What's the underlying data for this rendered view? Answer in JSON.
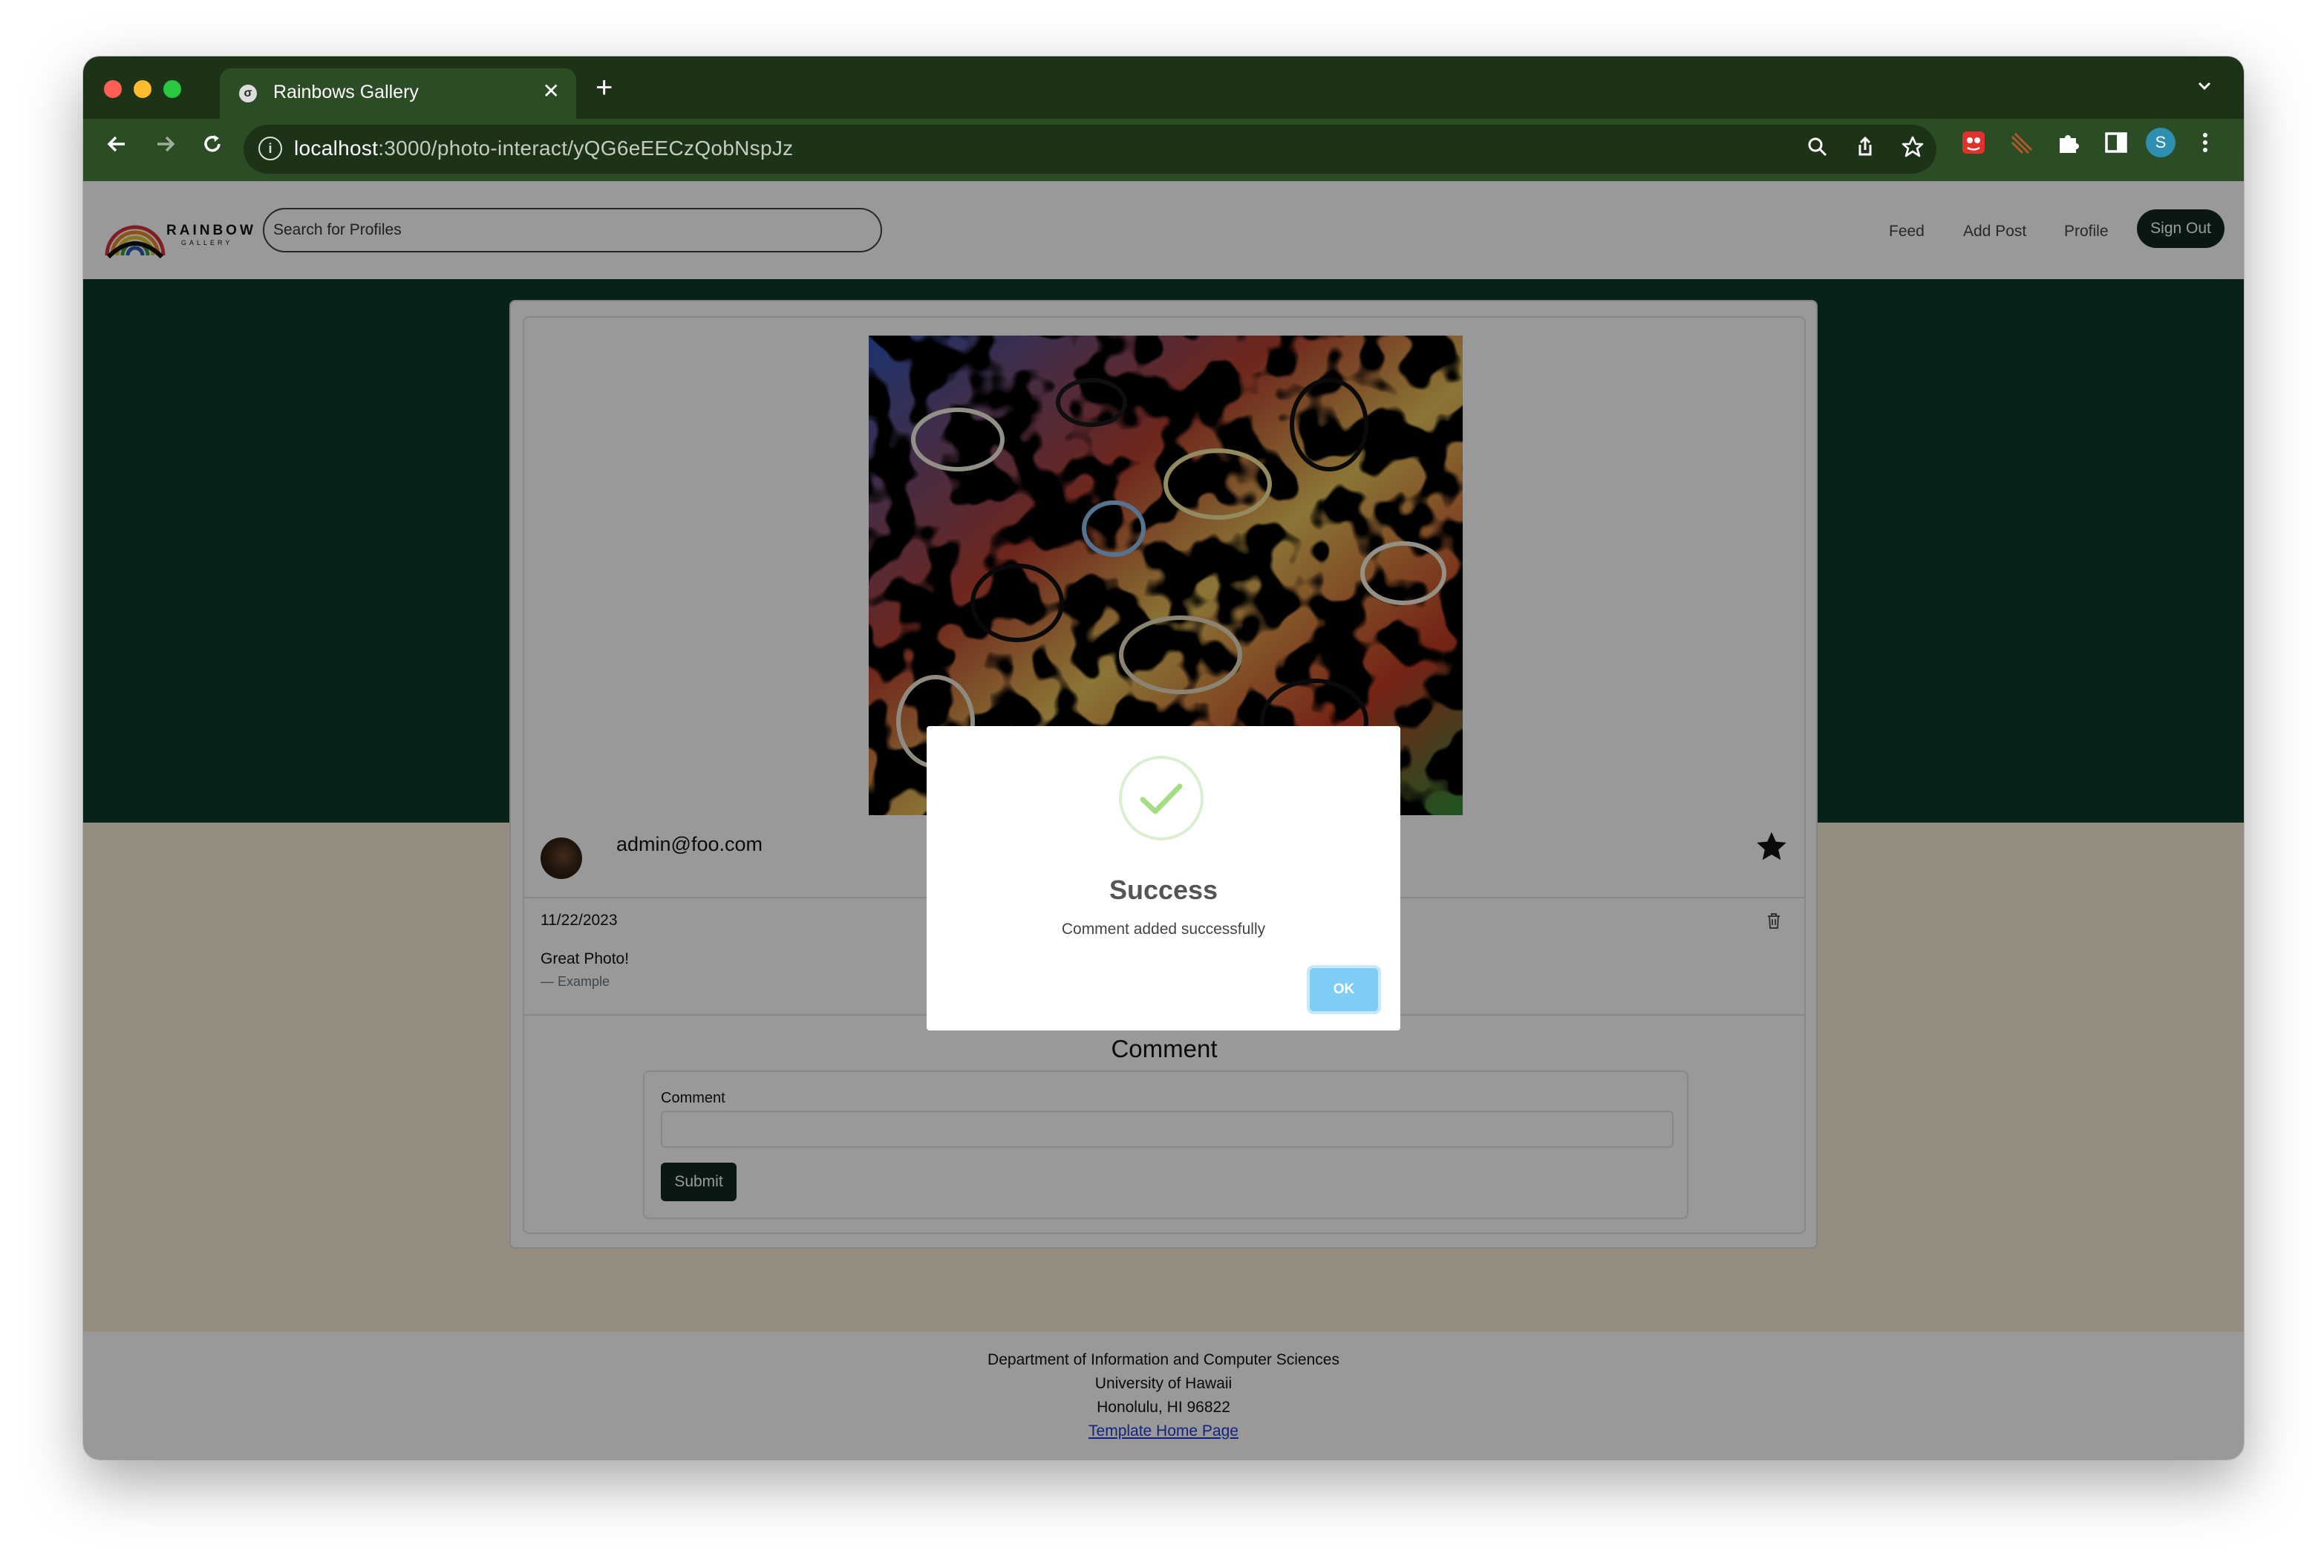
{
  "browser": {
    "tab_title": "Rainbows Gallery",
    "tab_close": "✕",
    "new_tab": "+",
    "url_host": "localhost",
    "url_path": ":3000/photo-interact/yQG6eEECzQobNspJz",
    "profile_initial": "S"
  },
  "navbar": {
    "logo_word": "RAINBOW",
    "logo_sub": "GALLERY",
    "search_placeholder": "Search for Profiles",
    "links": [
      "Feed",
      "Add Post",
      "Profile"
    ],
    "signout_label": "Sign Out"
  },
  "post": {
    "owner": "admin@foo.com",
    "comment_date": "11/22/2023",
    "comment_text": "Great Photo!",
    "comment_author": "— Example"
  },
  "comment_form": {
    "heading": "Comment",
    "field_label": "Comment",
    "submit_label": "Submit"
  },
  "modal": {
    "title": "Success",
    "message": "Comment added successfully",
    "ok_label": "OK"
  },
  "footer": {
    "line1": "Department of Information and Computer Sciences",
    "line2": "University of Hawaii",
    "line3": "Honolulu, HI 96822",
    "link": "Template Home Page"
  },
  "colors": {
    "chrome_dark": "#1c3318",
    "chrome_mid": "#2b4c25",
    "hero": "#0e3a2c",
    "tan": "#f7ecd5",
    "brand_button": "#0f2a1f",
    "ok_button": "#7fcdf5",
    "success_check": "#a5dc86"
  }
}
